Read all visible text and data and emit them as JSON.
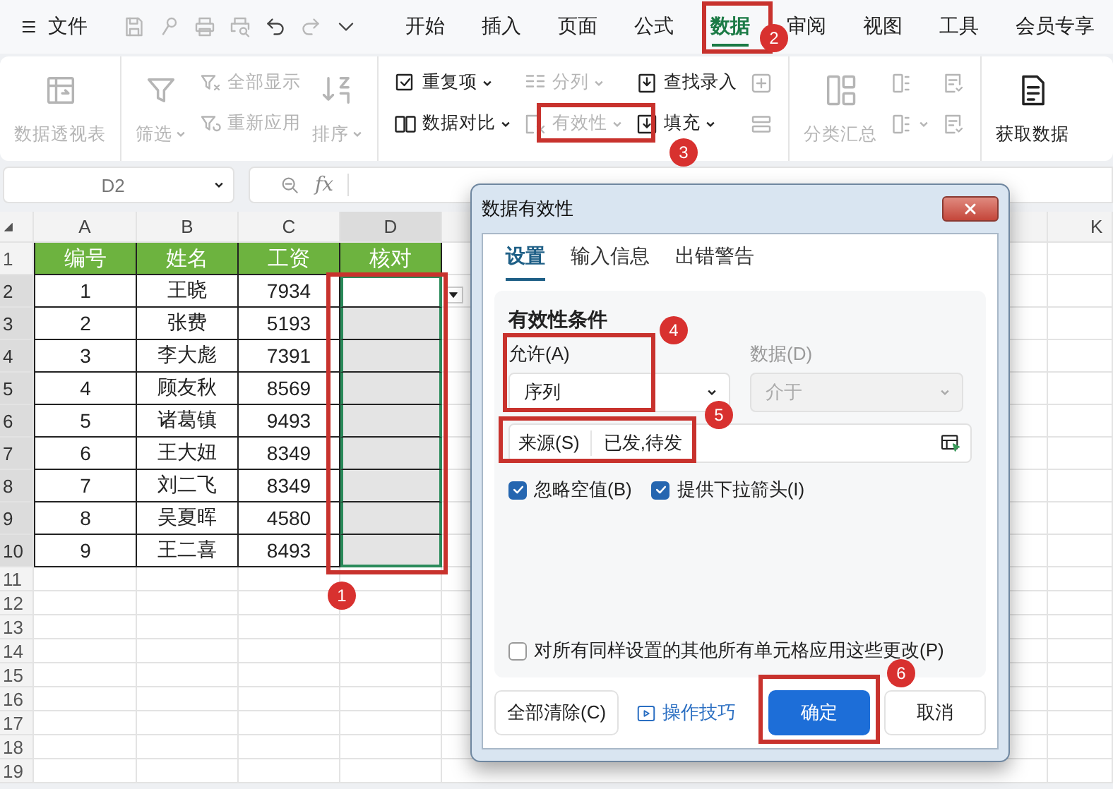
{
  "menubar": {
    "file_label": "文件",
    "quick_access": [
      {
        "disabled": true
      },
      {
        "disabled": true
      },
      {
        "disabled": true
      },
      {
        "disabled": true
      },
      {
        "disabled": false
      },
      {
        "disabled": true
      },
      {
        "disabled": false
      }
    ],
    "tabs": [
      {
        "label": "开始",
        "selected": false
      },
      {
        "label": "插入",
        "selected": false
      },
      {
        "label": "页面",
        "selected": false
      },
      {
        "label": "公式",
        "selected": false
      },
      {
        "label": "数据",
        "selected": true
      },
      {
        "label": "审阅",
        "selected": false
      },
      {
        "label": "视图",
        "selected": false
      },
      {
        "label": "工具",
        "selected": false
      },
      {
        "label": "会员专享",
        "selected": false
      }
    ]
  },
  "ribbon": {
    "groups": [
      {
        "columns": [
          [
            {
              "kind": "large",
              "label": "数据透视表",
              "dropdown": false,
              "disabled": true
            }
          ]
        ]
      },
      {
        "columns": [
          [
            {
              "kind": "large",
              "label": "筛选",
              "dropdown": true,
              "disabled": true
            }
          ],
          [
            {
              "kind": "small",
              "label": "全部显示",
              "dropdown": false,
              "disabled": true
            },
            {
              "kind": "small",
              "label": "重新应用",
              "dropdown": false,
              "disabled": true
            }
          ],
          [
            {
              "kind": "large",
              "label": "排序",
              "dropdown": true,
              "disabled": true
            }
          ]
        ]
      },
      {
        "columns": [
          [
            {
              "kind": "small",
              "label": "重复项",
              "dropdown": true,
              "disabled": false
            },
            {
              "kind": "small",
              "label": "数据对比",
              "dropdown": true,
              "disabled": false
            }
          ],
          [
            {
              "kind": "small",
              "label": "分列",
              "dropdown": true,
              "disabled": true
            },
            {
              "kind": "small",
              "label": "有效性",
              "dropdown": true,
              "disabled": true
            }
          ],
          [
            {
              "kind": "small",
              "label": "查找录入",
              "dropdown": false,
              "disabled": false
            },
            {
              "kind": "small",
              "label": "填充",
              "dropdown": true,
              "disabled": false
            }
          ],
          [
            {
              "kind": "icon",
              "dropdown": false,
              "disabled": true
            },
            {
              "kind": "icon",
              "dropdown": false,
              "disabled": true
            }
          ]
        ]
      },
      {
        "columns": [
          [
            {
              "kind": "large",
              "label": "分类汇总",
              "dropdown": false,
              "disabled": true
            }
          ],
          [
            {
              "kind": "icon",
              "dropdown": false,
              "disabled": true
            },
            {
              "kind": "icon",
              "dropdown": true,
              "disabled": true
            }
          ],
          [
            {
              "kind": "icon",
              "dropdown": false,
              "disabled": true
            },
            {
              "kind": "icon",
              "dropdown": false,
              "disabled": true
            }
          ]
        ]
      },
      {
        "columns": [
          [
            {
              "kind": "large",
              "label": "获取数据",
              "dropdown": false,
              "disabled": false
            }
          ]
        ]
      }
    ]
  },
  "formula_bar": {
    "name_box": "D2",
    "function_label": "fx"
  },
  "sheet": {
    "columns": [
      {
        "label": "A",
        "selected": false
      },
      {
        "label": "B",
        "selected": false
      },
      {
        "label": "C",
        "selected": false
      },
      {
        "label": "D",
        "selected": true
      },
      {
        "label": "K",
        "selected": false
      }
    ],
    "rows": [
      {
        "number": "1",
        "kind": "header",
        "selected": false,
        "cells": [
          "编号",
          "姓名",
          "工资",
          "核对"
        ]
      },
      {
        "number": "2",
        "kind": "data",
        "selected": true,
        "cells": [
          "1",
          "王晓",
          "7934"
        ],
        "check_cell": {
          "selected": true,
          "active": true
        }
      },
      {
        "number": "3",
        "kind": "data",
        "selected": true,
        "cells": [
          "2",
          "张费",
          "5193"
        ],
        "check_cell": {
          "selected": true,
          "active": false
        }
      },
      {
        "number": "4",
        "kind": "data",
        "selected": true,
        "cells": [
          "3",
          "李大彪",
          "7391"
        ],
        "check_cell": {
          "selected": true,
          "active": false
        }
      },
      {
        "number": "5",
        "kind": "data",
        "selected": true,
        "cells": [
          "4",
          "顾友秋",
          "8569"
        ],
        "check_cell": {
          "selected": true,
          "active": false
        }
      },
      {
        "number": "6",
        "kind": "data",
        "selected": true,
        "cells": [
          "5",
          "诸葛镇",
          "9493"
        ],
        "check_cell": {
          "selected": true,
          "active": false
        }
      },
      {
        "number": "7",
        "kind": "data",
        "selected": true,
        "cells": [
          "6",
          "王大妞",
          "8349"
        ],
        "check_cell": {
          "selected": true,
          "active": false
        }
      },
      {
        "number": "8",
        "kind": "data",
        "selected": true,
        "cells": [
          "7",
          "刘二飞",
          "8349"
        ],
        "check_cell": {
          "selected": true,
          "active": false
        }
      },
      {
        "number": "9",
        "kind": "data",
        "selected": true,
        "cells": [
          "8",
          "吴夏晖",
          "4580"
        ],
        "check_cell": {
          "selected": true,
          "active": false
        }
      },
      {
        "number": "10",
        "kind": "data",
        "selected": true,
        "cells": [
          "9",
          "王二喜",
          "8493"
        ],
        "check_cell": {
          "selected": true,
          "active": false
        }
      },
      {
        "number": "11",
        "kind": "empty",
        "selected": false
      },
      {
        "number": "12",
        "kind": "empty",
        "selected": false
      },
      {
        "number": "13",
        "kind": "empty",
        "selected": false
      },
      {
        "number": "14",
        "kind": "empty",
        "selected": false
      },
      {
        "number": "15",
        "kind": "empty",
        "selected": false
      },
      {
        "number": "16",
        "kind": "empty",
        "selected": false
      },
      {
        "number": "17",
        "kind": "empty",
        "selected": false
      },
      {
        "number": "18",
        "kind": "empty",
        "selected": false
      },
      {
        "number": "19",
        "kind": "empty",
        "selected": false
      }
    ]
  },
  "dialog": {
    "title": "数据有效性",
    "tabs": [
      {
        "label": "设置",
        "selected": true
      },
      {
        "label": "输入信息",
        "selected": false
      },
      {
        "label": "出错警告",
        "selected": false
      }
    ],
    "section_title": "有效性条件",
    "allow": {
      "label": "允许(A)",
      "value": "序列",
      "disabled": false
    },
    "data": {
      "label": "数据(D)",
      "value": "介于",
      "disabled": true
    },
    "source": {
      "label": "来源(S)",
      "value": "已发,待发"
    },
    "checkboxes": [
      {
        "label": "忽略空值(B)",
        "checked": true
      },
      {
        "label": "提供下拉箭头(I)",
        "checked": true
      }
    ],
    "apply_all": {
      "label": "对所有同样设置的其他所有单元格应用这些更改(P)",
      "checked": false
    },
    "buttons": [
      {
        "kind": "secondary",
        "label": "全部清除(C)"
      },
      {
        "kind": "link",
        "label": "操作技巧"
      },
      {
        "kind": "primary",
        "label": "确定"
      },
      {
        "kind": "secondary",
        "label": "取消"
      }
    ]
  },
  "annotations": [
    {
      "number": "1"
    },
    {
      "number": "2"
    },
    {
      "number": "3"
    },
    {
      "number": "4"
    },
    {
      "number": "5"
    },
    {
      "number": "6"
    }
  ]
}
